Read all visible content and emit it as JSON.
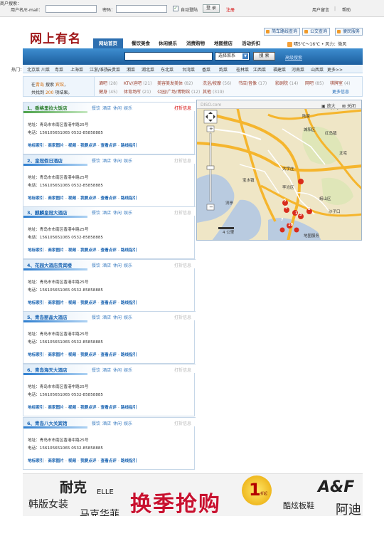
{
  "topbar": {
    "user_label": "用户名/E-mail：",
    "password_label": "密码：",
    "remember_label": "自动登陆",
    "login_button": "登 录",
    "register_link": "注册",
    "feedback_link": "用户留言",
    "help_link": "帮助",
    "separator": "|"
  },
  "header": {
    "logo_text": "网上有名",
    "quick_buttons": [
      "简车路线查询",
      "公交查询",
      "便民服务"
    ]
  },
  "nav": {
    "items": [
      "网站首页",
      "餐饮美食",
      "休闲娱乐",
      "消费购物",
      "地图搜店",
      "活动折扣"
    ]
  },
  "weather": {
    "temp": "晴5℃～16℃",
    "wind": "• 风力：微风"
  },
  "search": {
    "label": "商户搜索：",
    "input_value": "",
    "select_value": "选择菜系",
    "button": "搜 索",
    "advanced": "高级搜索"
  },
  "hot": {
    "label": "热门：",
    "items": [
      "北京菜",
      "川菜",
      "粤菜",
      "上海菜",
      "江浙/淮扬",
      "云贵菜",
      "湘菜",
      "湖北菜",
      "东北菜",
      "台湾菜",
      "香菜",
      "韵菜",
      "桂林菜",
      "江西菜",
      "福建菜",
      "河南菜",
      "山西菜",
      "更多>>"
    ]
  },
  "filter": {
    "line1_prefix": "在",
    "line1_city": "青岛",
    "line1_mid": "搜索",
    "line1_keyword": "宾馆",
    "line1_suffix": "，",
    "line2_prefix": "共找到",
    "line2_count": "200",
    "line2_suffix": "项结果。",
    "row1": [
      {
        "name": "酒吧",
        "count": "(28)"
      },
      {
        "name": "KTV/迪吧",
        "count": "(21)"
      },
      {
        "name": "美容美发美体",
        "count": "(82)"
      },
      {
        "name": "洗浴/按摩",
        "count": "(56)"
      },
      {
        "name": "书店/音像",
        "count": "(17)"
      },
      {
        "name": "影剧院",
        "count": "(14)"
      },
      {
        "name": "网吧",
        "count": "(85)"
      },
      {
        "name": "棋牌室",
        "count": "(4)"
      }
    ],
    "row2": [
      {
        "name": "健身",
        "count": "(45)"
      },
      {
        "name": "体育场所",
        "count": "(21)"
      },
      {
        "name": "公园/广场/博物馆",
        "count": "(12)"
      },
      {
        "name": "其他",
        "count": "(319)"
      }
    ],
    "more": "更多信息"
  },
  "results": [
    {
      "title": "1、香格里拉大饭店",
      "tabs": [
        "餐饮",
        "酒店",
        "休闲",
        "娱乐"
      ],
      "discount": "打折信息",
      "active": true,
      "addr": "地址：青岛市市南区香港中路25号",
      "tel": "电话：156105651065   0532-85858885",
      "links": [
        "地标索引",
        "商家图片",
        "视频",
        "我要点评",
        "查看点评",
        "路线指引"
      ]
    },
    {
      "title": "2、皇冠假日酒店",
      "tabs": [
        "餐饮",
        "酒店",
        "休闲",
        "娱乐"
      ],
      "discount": "打折信息",
      "active": false,
      "addr": "地址：青岛市市南区香港中路25号",
      "tel": "电话：156105651065   0532-85858885",
      "links": [
        "地标索引",
        "商家图片",
        "视频",
        "我要点评",
        "查看点评",
        "路线指引"
      ]
    },
    {
      "title": "3、麒麟皇冠大酒店",
      "tabs": [
        "餐饮",
        "酒店",
        "休闲",
        "娱乐"
      ],
      "discount": "打折信息",
      "active": false,
      "addr": "地址：青岛市市南区香港中路25号",
      "tel": "电话：156105651065   0532-85858885",
      "links": [
        "地标索引",
        "商家图片",
        "视频",
        "我要点评",
        "查看点评",
        "路线指引"
      ]
    },
    {
      "title": "4、花园大酒店贵宾楼",
      "tabs": [
        "餐饮",
        "酒店",
        "休闲",
        "娱乐"
      ],
      "discount": "打折信息",
      "active": false,
      "addr": "地址：青岛市市南区香港中路25号",
      "tel": "电话：156105651065   0532-85858885",
      "links": [
        "地标索引",
        "商家图片",
        "视频",
        "我要点评",
        "查看点评",
        "路线指引"
      ]
    },
    {
      "title": "5、青岛丽晶大酒店",
      "tabs": [
        "餐饮",
        "酒店",
        "休闲",
        "娱乐"
      ],
      "discount": "打折信息",
      "active": false,
      "addr": "地址：青岛市市南区香港中路25号",
      "tel": "电话：156105651065   0532-85858885",
      "links": [
        "地标索引",
        "商家图片",
        "视频",
        "我要点评",
        "查看点评",
        "路线指引"
      ]
    },
    {
      "title": "6、青岛海天大酒店",
      "tabs": [
        "餐饮",
        "酒店",
        "休闲",
        "娱乐"
      ],
      "discount": "打折信息",
      "active": false,
      "addr": "地址：青岛市市南区香港中路25号",
      "tel": "电话：156105651065   0532-85858885",
      "links": [
        "地标索引",
        "商家图片",
        "视频",
        "我要点评",
        "查看点评",
        "路线指引"
      ]
    },
    {
      "title": "6、青岛八大关宾馆",
      "tabs": [
        "餐饮",
        "酒店",
        "休闲",
        "娱乐"
      ],
      "discount": "打折信息",
      "active": false,
      "addr": "地址：青岛市市南区香港中路25号",
      "tel": "电话：156105651065   0532-85858885",
      "links": [
        "地标索引",
        "商家图片",
        "视频",
        "我要点评",
        "查看点评",
        "路线指引"
      ]
    }
  ],
  "map": {
    "watermark": "DISO.com",
    "enlarge": "放大",
    "close": "关闭",
    "place_labels": [
      "陆家",
      "黄岛",
      "城阳区",
      "红岛镇",
      "北宅",
      "宝水镇",
      "大宇庄",
      "李沧区",
      "崂山区",
      "流亭",
      "沙子口",
      "4 公里",
      "地图服务"
    ],
    "markers": [
      "5",
      "6",
      "7",
      "1",
      "2",
      "3",
      "10"
    ]
  },
  "ad": {
    "brand1": "耐克",
    "brand2": "ELLE",
    "tag1": "韩版女装",
    "tag2": "马克华菲",
    "headline": "换季抢购",
    "badge_num": "1",
    "badge_suffix": "折起",
    "brand3": "A&F",
    "tag3": "酷炫板鞋",
    "tag4": "阿迪"
  }
}
